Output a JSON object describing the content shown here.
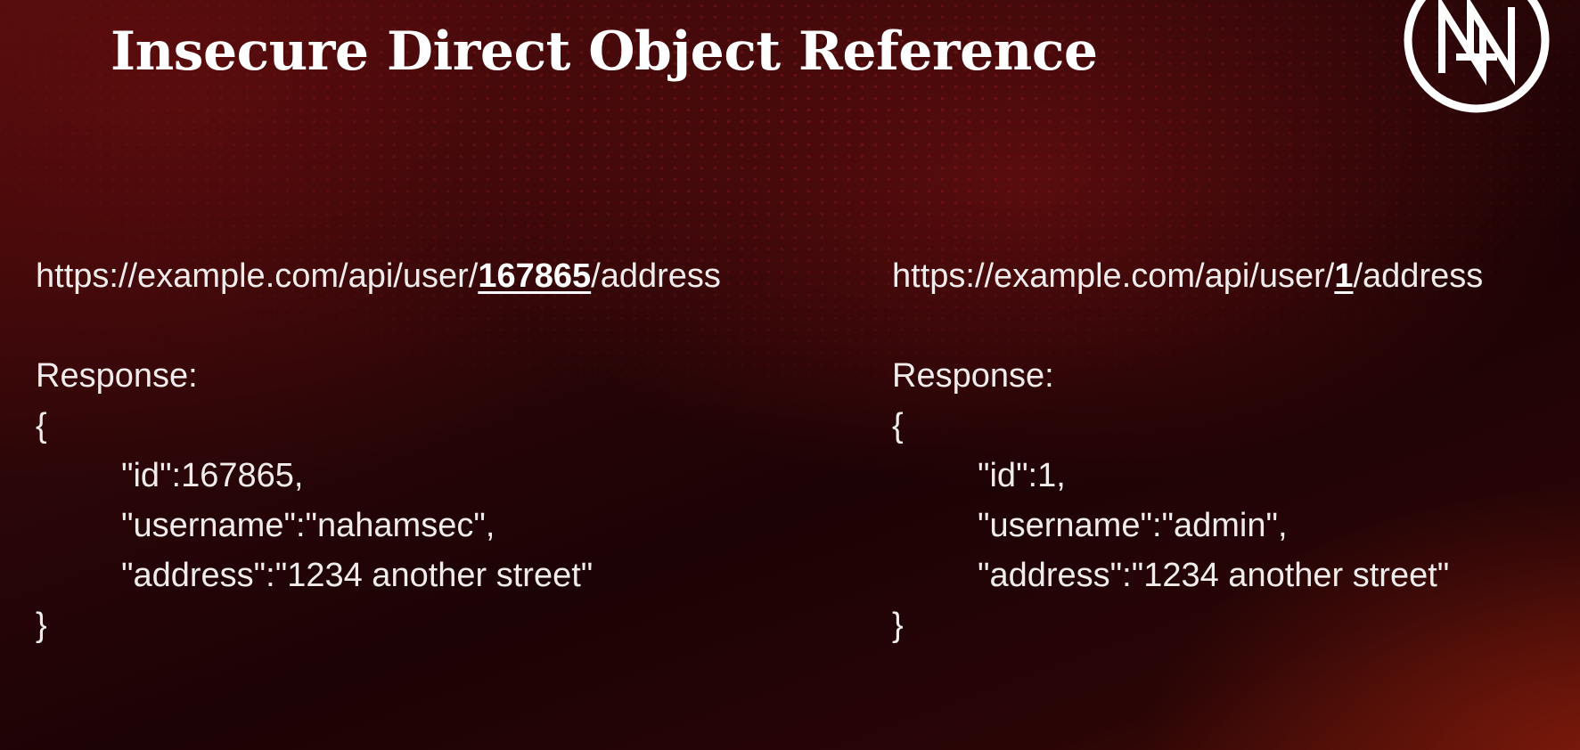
{
  "slide": {
    "title": "Insecure Direct Object Reference",
    "logo_label": "N"
  },
  "left": {
    "url_prefix": "https://example.com/api/user/",
    "url_id": "167865",
    "url_suffix": "/address",
    "response_label": "Response:",
    "open_brace": "{",
    "lines": [
      "\"id\":167865,",
      "\"username\":\"nahamsec\",",
      "\"address\":\"1234 another street\""
    ],
    "close_brace": "}"
  },
  "right": {
    "url_prefix": "https://example.com/api/user/",
    "url_id": "1",
    "url_suffix": "/address",
    "response_label": "Response:",
    "open_brace": "{",
    "lines": [
      "\"id\":1,",
      "\"username\":\"admin\",",
      "\"address\":\"1234 another street\""
    ],
    "close_brace": "}"
  },
  "colors": {
    "background": "#2c0608",
    "accent": "#8a1414",
    "text": "#ffffff"
  },
  "icons": {
    "logo": "nahamsec-logo-icon"
  }
}
